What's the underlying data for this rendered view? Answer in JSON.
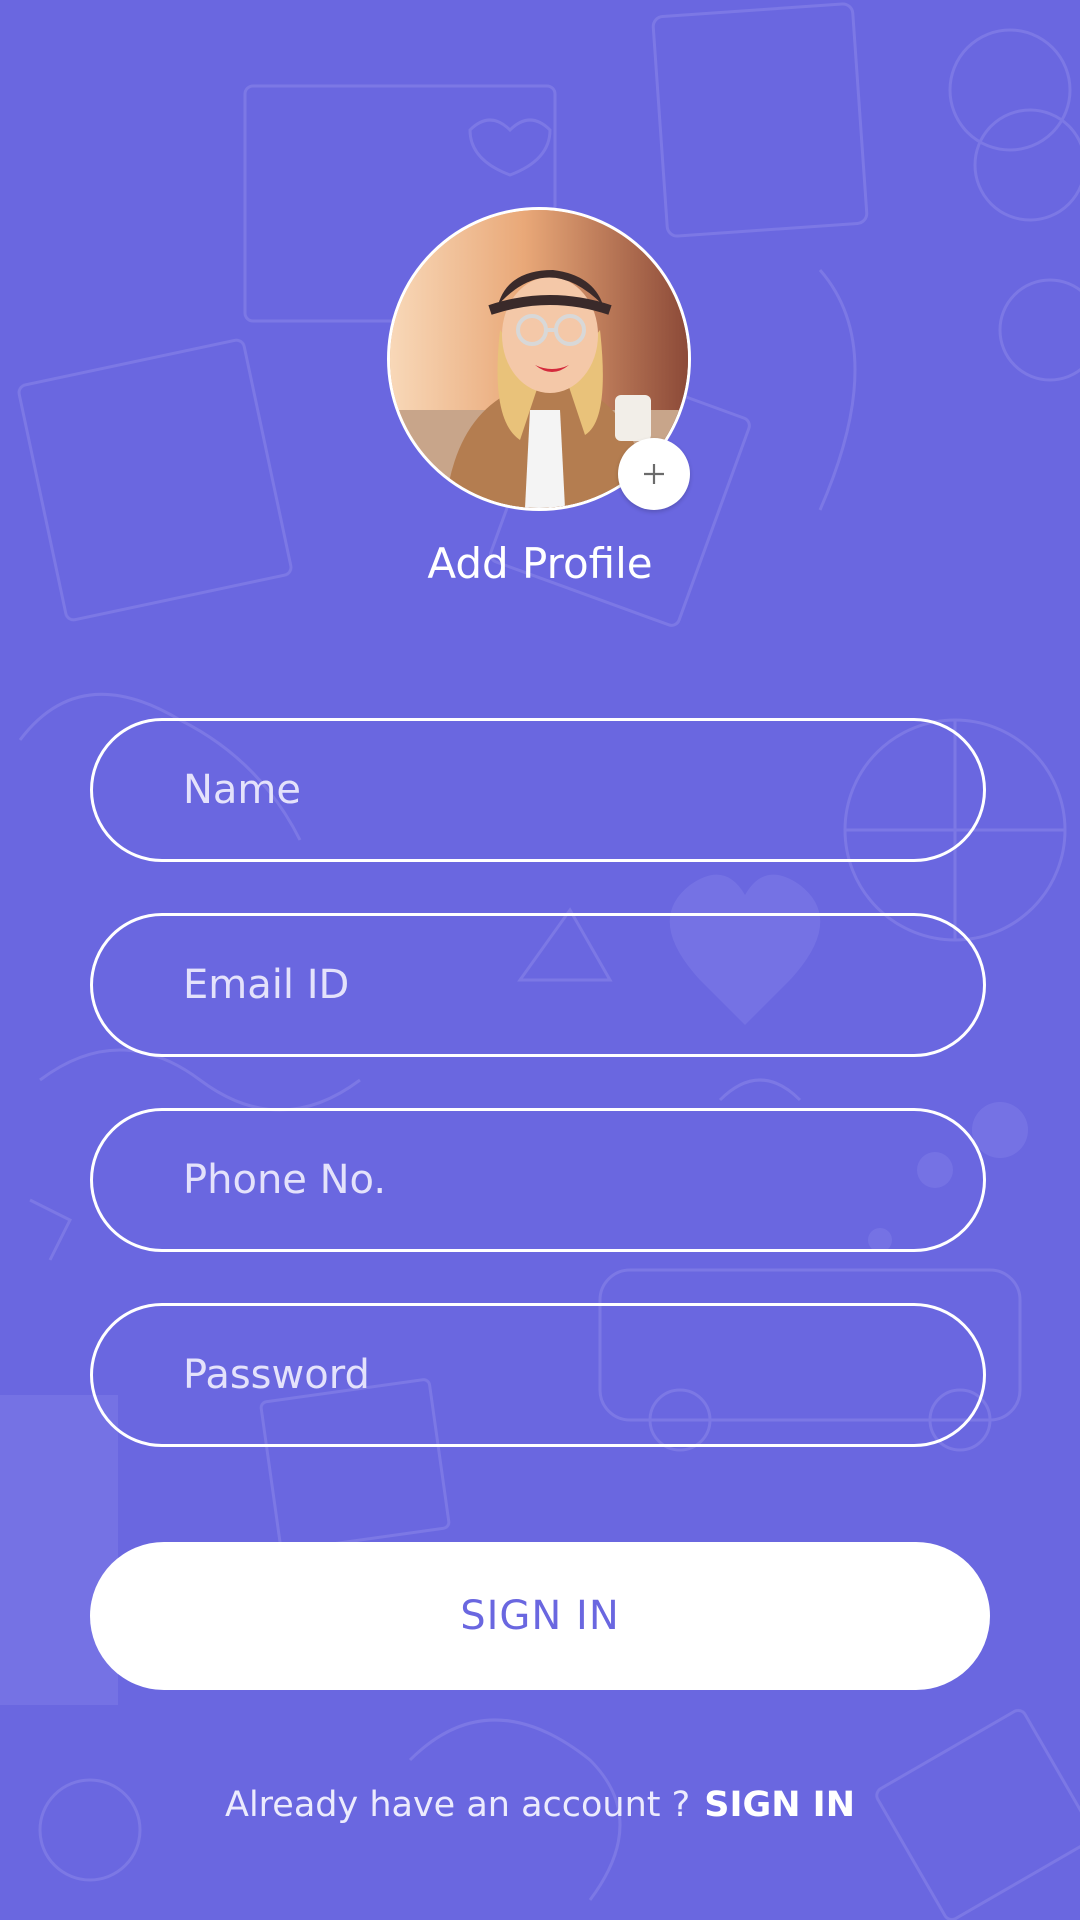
{
  "profile": {
    "add_label": "Add Profile"
  },
  "form": {
    "name_placeholder": "Name",
    "email_placeholder": "Email ID",
    "phone_placeholder": "Phone No.",
    "password_placeholder": "Password",
    "submit_label": "SIGN IN"
  },
  "footer": {
    "prompt": "Already have an account ?",
    "link_label": "SIGN IN"
  },
  "colors": {
    "background": "#6a67e0",
    "accent_text": "#6a67e0",
    "field_border": "#ffffff"
  },
  "icons": {
    "add_photo": "plus-icon"
  }
}
